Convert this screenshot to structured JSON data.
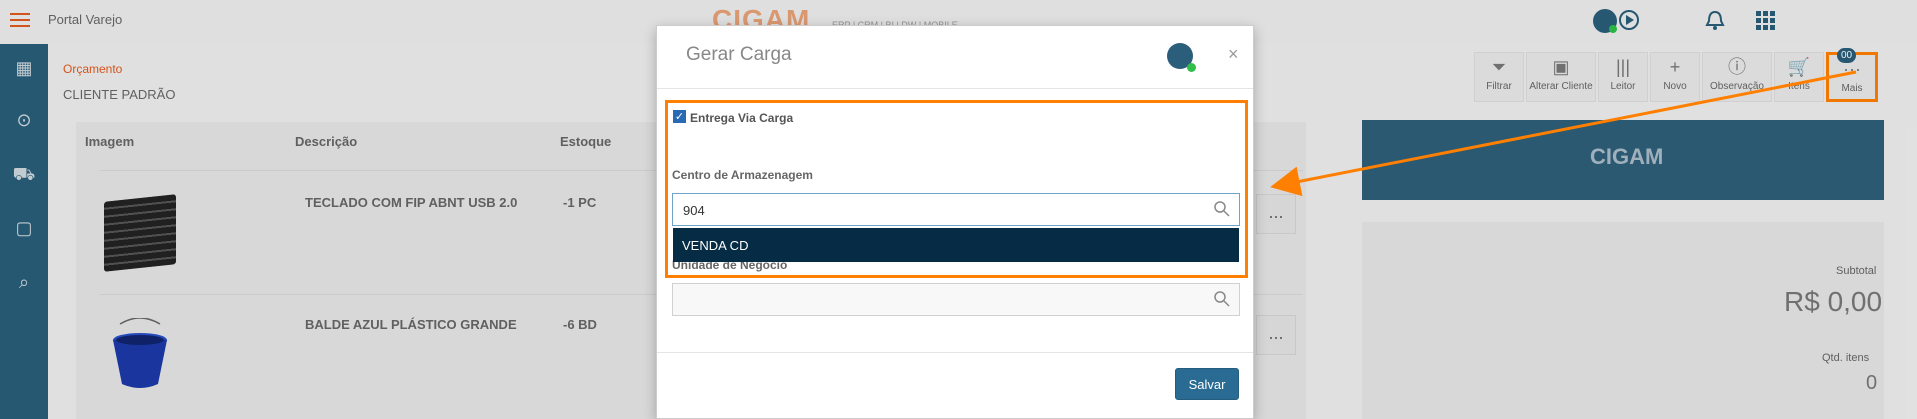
{
  "app": {
    "title": "Portal Varejo",
    "brand": "CIGAM",
    "brand_sub": "ERP | CRM | BI | DW | MOBILE"
  },
  "header": {
    "breadcrumb": "Orçamento",
    "client": "CLIENTE PADRÃO"
  },
  "toolbar": {
    "buttons": [
      {
        "label": "Filtrar",
        "icon": "filter-icon"
      },
      {
        "label": "Alterar Cliente",
        "icon": "user-card-icon"
      },
      {
        "label": "Leitor",
        "icon": "barcode-icon"
      },
      {
        "label": "Novo",
        "icon": "plus-icon"
      },
      {
        "label": "Observação",
        "icon": "info-icon"
      },
      {
        "label": "Itens",
        "icon": "cart-icon"
      },
      {
        "label": "Mais",
        "icon": "more-icon"
      }
    ],
    "cart_badge": "00"
  },
  "table": {
    "headers": {
      "image": "Imagem",
      "description": "Descrição",
      "stock": "Estoque"
    },
    "rows": [
      {
        "name": "TECLADO COM FIP ABNT USB 2.0",
        "stock": "-1 PC",
        "more": "..."
      },
      {
        "name": "BALDE AZUL PLÁSTICO GRANDE",
        "stock": "-6 BD",
        "more": "..."
      }
    ]
  },
  "summary": {
    "logo": "CIGAM",
    "subtotal_label": "Subtotal",
    "subtotal_value": "R$ 0,00",
    "qtd_label": "Qtd. itens",
    "qtd_value": "0"
  },
  "modal": {
    "title": "Gerar Carga",
    "close": "×",
    "checkbox_label": "Entrega Via Carga",
    "checkbox_checked": true,
    "field1_label": "Centro de Armazenagem",
    "field1_value": "904",
    "dropdown_option": "VENDA CD",
    "field2_label": "Unidade de Negócio",
    "field2_value": "",
    "save_label": "Salvar"
  },
  "colors": {
    "accent": "#ff7f00",
    "sidebar": "#2a5e7a",
    "primary_button": "#2a6b93",
    "dropdown_bg": "#052b45"
  }
}
